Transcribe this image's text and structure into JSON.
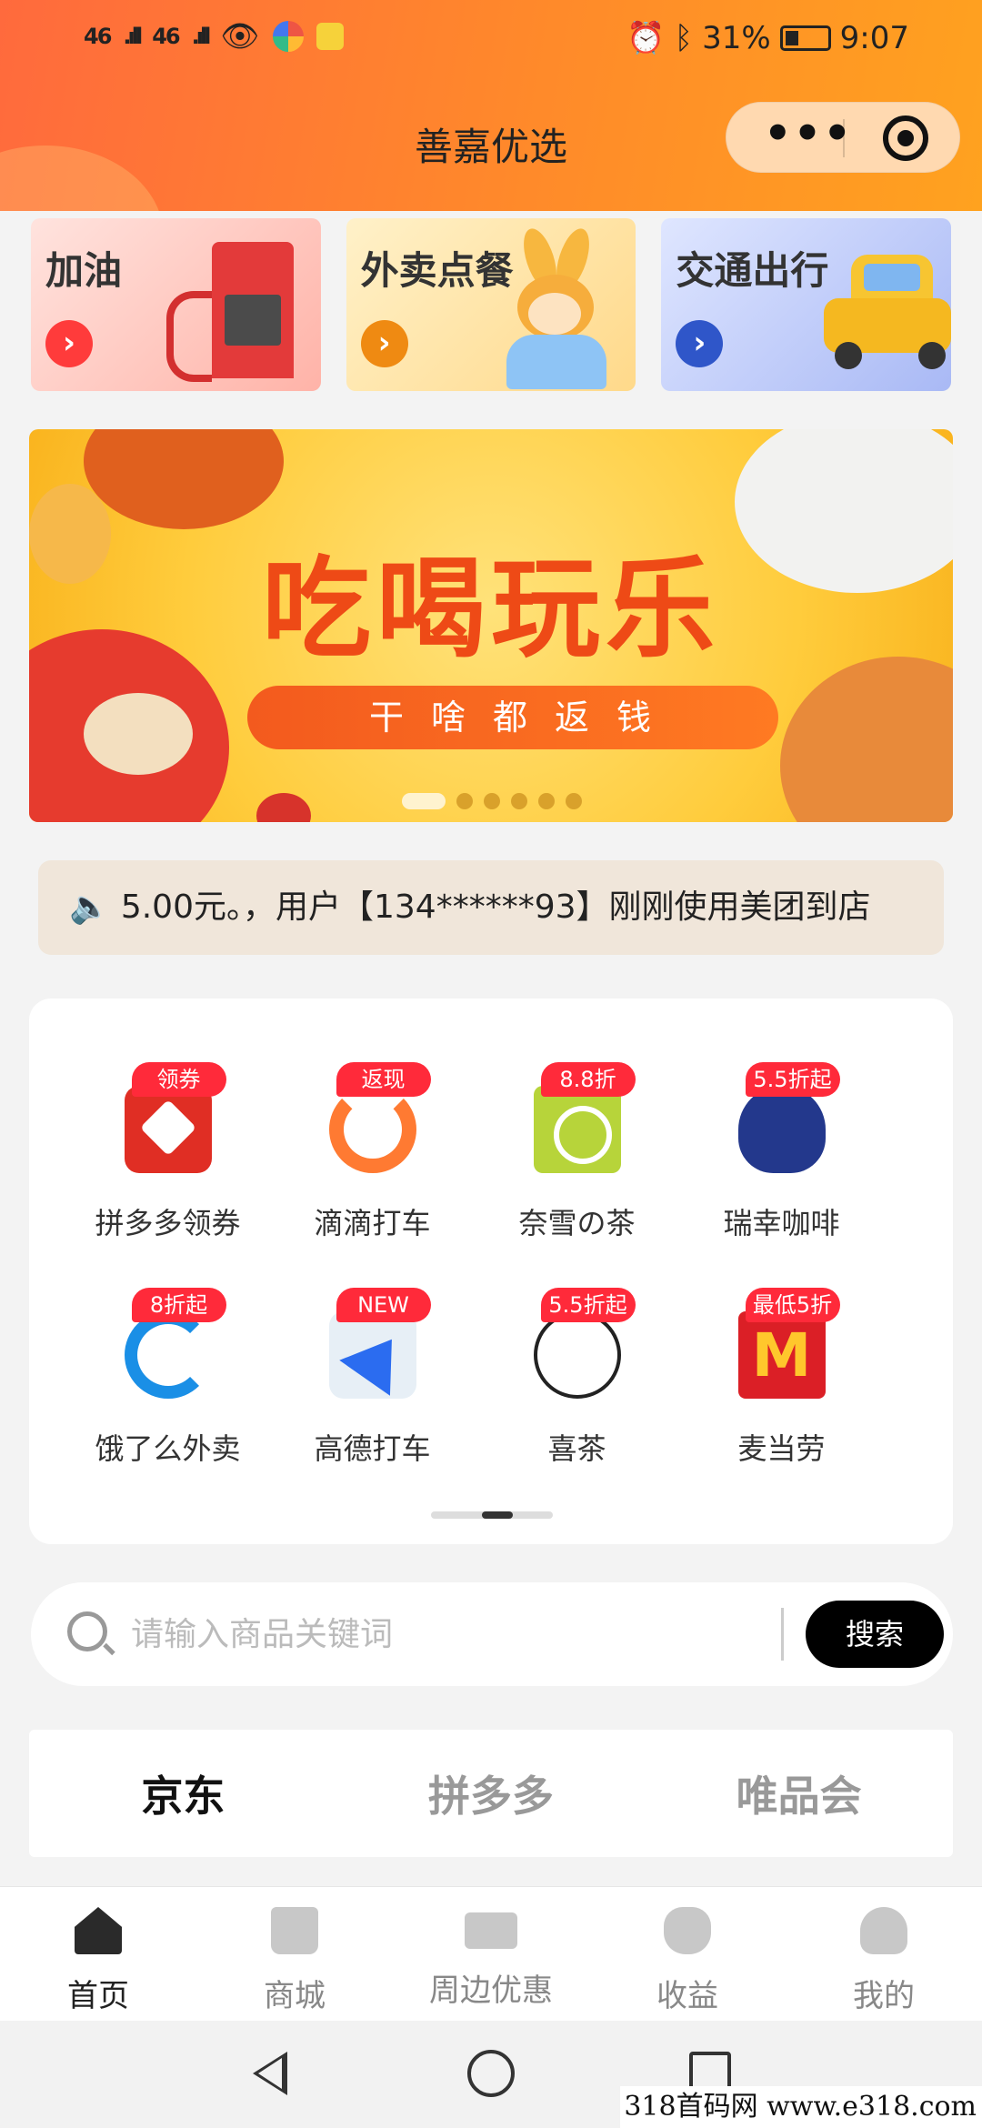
{
  "status_bar": {
    "signal1": "46",
    "signal2": "46",
    "battery_percent": "31%",
    "time": "9:07"
  },
  "header": {
    "title": "善嘉优选",
    "more_label": "•••"
  },
  "category_cards": [
    {
      "label": "加油",
      "arrow": "›"
    },
    {
      "label": "外卖点餐",
      "arrow": "›"
    },
    {
      "label": "交通出行",
      "arrow": "›"
    }
  ],
  "banner": {
    "headline": "吃喝玩乐",
    "subtitle": "干啥都返钱",
    "slide_count": 6,
    "active_slide": 1
  },
  "notice": {
    "text": "5.00元。，用户【134******93】刚刚使用美团到店"
  },
  "services": [
    {
      "label": "拼多多领券",
      "badge": "领券",
      "icon": "pinduoduo-icon"
    },
    {
      "label": "滴滴打车",
      "badge": "返现",
      "icon": "didi-icon"
    },
    {
      "label": "奈雪の茶",
      "badge": "8.8折",
      "icon": "nayuki-icon"
    },
    {
      "label": "瑞幸咖啡",
      "badge": "5.5折起",
      "icon": "luckin-icon"
    },
    {
      "label": "饿了么外卖",
      "badge": "8折起",
      "icon": "eleme-icon"
    },
    {
      "label": "高德打车",
      "badge": "NEW",
      "icon": "amap-icon"
    },
    {
      "label": "喜茶",
      "badge": "5.5折起",
      "icon": "heytea-icon"
    },
    {
      "label": "麦当劳",
      "badge": "最低5折",
      "icon": "mcdonalds-icon"
    }
  ],
  "search": {
    "placeholder": "请输入商品关键词",
    "value": "",
    "button_label": "搜索"
  },
  "platform_tabs": [
    {
      "label": "京东",
      "active": true
    },
    {
      "label": "拼多多",
      "active": false
    },
    {
      "label": "唯品会",
      "active": false
    }
  ],
  "tabbar": [
    {
      "label": "首页",
      "icon": "home-icon",
      "active": true
    },
    {
      "label": "商城",
      "icon": "shopping-bag-icon",
      "active": false
    },
    {
      "label": "周边优惠",
      "icon": "coupon-icon",
      "active": false
    },
    {
      "label": "收益",
      "icon": "money-bag-icon",
      "active": false
    },
    {
      "label": "我的",
      "icon": "user-icon",
      "active": false
    }
  ],
  "watermark": "318首码网 www.e318.com",
  "colors": {
    "header_start": "#ff6a3d",
    "header_end": "#ffa21f",
    "badge": "#ff2a3a",
    "banner_headline": "#ee4a16"
  }
}
